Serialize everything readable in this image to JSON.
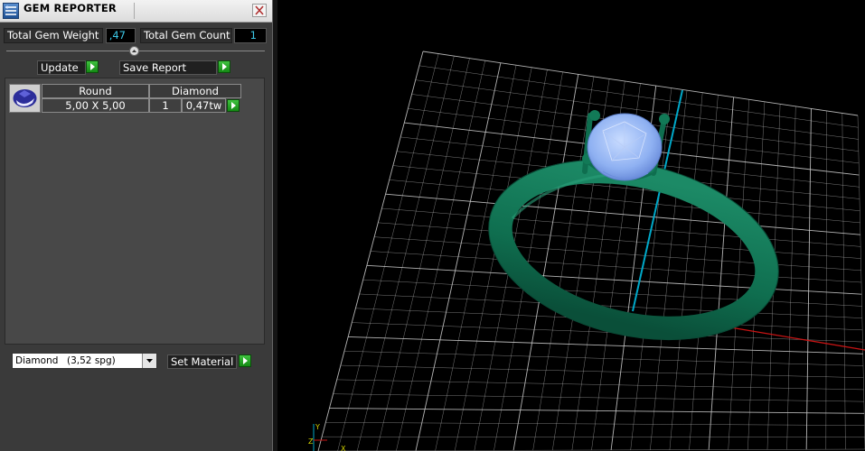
{
  "window": {
    "title": "GEM REPORTER",
    "icon": "gem-reporter-app-icon",
    "close_icon": "close-icon"
  },
  "totals": {
    "weight_label": "Total Gem Weight",
    "weight_value": ",47",
    "count_label": "Total Gem Count",
    "count_value": "1"
  },
  "toolbar": {
    "collapse_icon": "chevron-up-icon",
    "update_label": "Update",
    "save_label": "Save Report",
    "arrow_icon": "play-arrow-icon"
  },
  "gem_table": {
    "thumbnail_icon": "round-gem-icon",
    "rows": [
      {
        "shape": "Round",
        "material": "Diamond",
        "size": "5,00 X 5,00",
        "count": "1",
        "weight": "0,47tw"
      }
    ]
  },
  "material_select": {
    "selected_name": "Diamond",
    "selected_spg": "(3,52 spg)",
    "dropdown_icon": "chevron-down-icon",
    "set_label": "Set Material"
  },
  "viewport": {
    "model": "solitaire-ring",
    "ring_color": "#0f6e4f",
    "gem_color": "#8fb1f2",
    "grid_color": "#c8c8c8",
    "axis_y_color": "#00a8c8",
    "axis_x_color": "#c81414",
    "axis_indicator_labels": [
      "Y",
      "Z",
      "X"
    ]
  },
  "colors": {
    "panel_bg": "#3a3a3a",
    "value_text": "#3cc9e8",
    "accent_green": "#2aa82a"
  }
}
